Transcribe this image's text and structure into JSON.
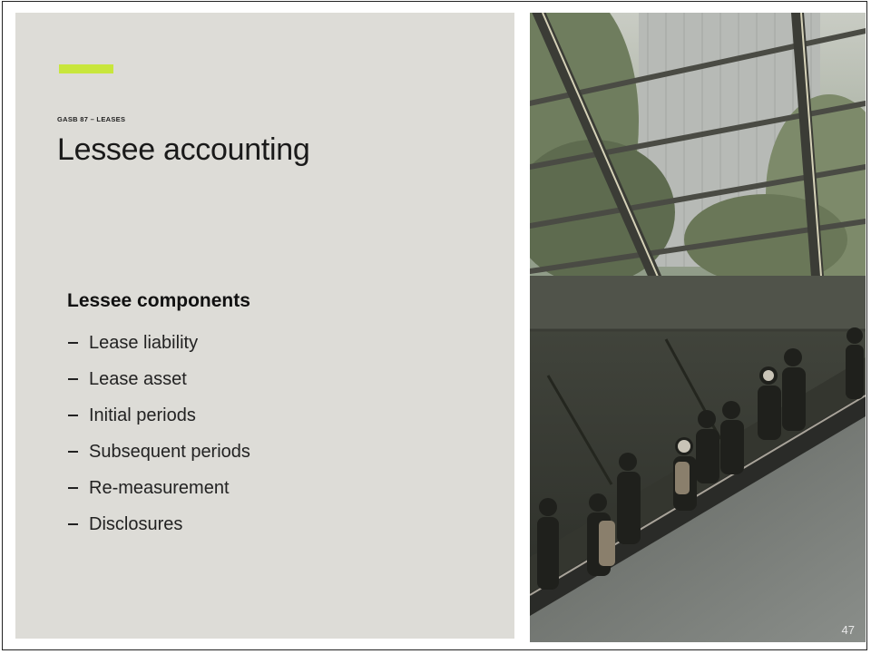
{
  "slide": {
    "eyebrow": "GASB 87 – LEASES",
    "title": "Lessee accounting",
    "section_heading": "Lessee components",
    "bullets": [
      "Lease liability",
      "Lease asset",
      "Initial periods",
      "Subsequent periods",
      "Re-measurement",
      "Disclosures"
    ],
    "page_number": "47"
  },
  "colors": {
    "accent": "#c8e63c",
    "panel_background": "#dddcd7"
  },
  "photo": {
    "subject": "escalator-with-commuters-under-glass-canopy"
  }
}
